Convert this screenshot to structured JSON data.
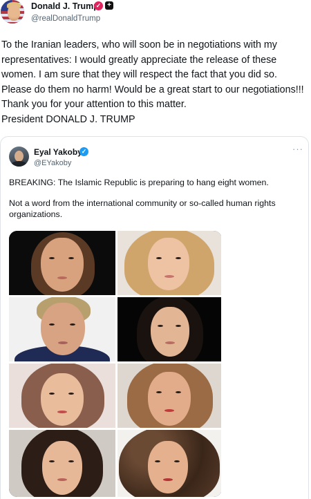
{
  "post": {
    "author_name": "Donald J. Trump",
    "author_handle": "@realDonaldTrump",
    "text": "To the Iranian leaders, who will soon be in negotiations with my representatives: I would greatly appreciate the release of these women. I am sure that they will respect the fact that you did so. Please do them no harm! Would be a great start to our negotiations!!! Thank you for your attention to this matter.\nPresident DONALD J. TRUMP",
    "verified_color": "#e0245e"
  },
  "quote": {
    "author_name": "Eyal Yakoby",
    "author_handle": "@EYakoby",
    "paragraphs": [
      "BREAKING: The Islamic Republic is preparing to hang eight women.",
      "Not a word from the international community or so-called human rights organizations."
    ],
    "verified_color": "#1d9bf0",
    "photo_count": 8
  },
  "icons": {
    "verified": "verified-badge-icon",
    "more": "more-options-icon"
  }
}
